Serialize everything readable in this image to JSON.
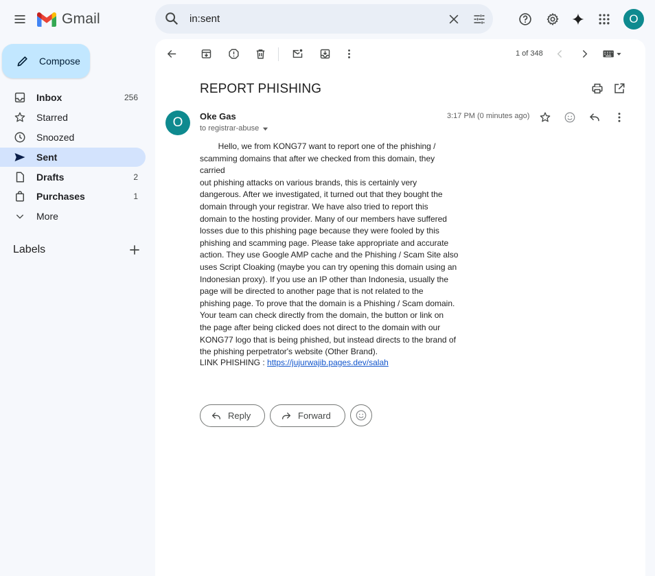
{
  "header": {
    "app_name": "Gmail",
    "search_value": "in:sent"
  },
  "user": {
    "initial": "O"
  },
  "sidebar": {
    "compose_label": "Compose",
    "items": [
      {
        "label": "Inbox",
        "count": "256"
      },
      {
        "label": "Starred",
        "count": ""
      },
      {
        "label": "Snoozed",
        "count": ""
      },
      {
        "label": "Sent",
        "count": ""
      },
      {
        "label": "Drafts",
        "count": "2"
      },
      {
        "label": "Purchases",
        "count": "1"
      },
      {
        "label": "More",
        "count": ""
      }
    ],
    "labels_heading": "Labels"
  },
  "toolbar": {
    "pager": "1 of 348"
  },
  "message": {
    "subject": "REPORT PHISHING",
    "sender_initial": "O",
    "sender_name": "Oke Gas",
    "recipient": "to registrar-abuse",
    "timestamp": "3:17 PM (0 minutes ago)",
    "body": "        Hello, we from KONG77 want to report one of the phishing /\nscamming domains that after we checked from this domain, they carried\nout phishing attacks on various brands, this is certainly very\ndangerous. After we investigated, it turned out that they bought the\ndomain through your registrar. We have also tried to report this\ndomain to the hosting provider. Many of our members have suffered\nlosses due to this phishing page because they were fooled by this\nphishing and scamming page. Please take appropriate and accurate\naction. They use Google AMP cache and the Phishing / Scam Site also\nuses Script Cloaking (maybe you can try opening this domain using an\nIndonesian proxy). If you use an IP other than Indonesia, usually the\npage will be directed to another page that is not related to the\nphishing page. To prove that the domain is a Phishing / Scam domain.\nYour team can check directly from the domain, the button or link on\nthe page after being clicked does not direct to the domain with our\nKONG77 logo that is being phished, but instead directs to the brand of\nthe phishing perpetrator's website (Other Brand).",
    "link_prefix": "LINK PHISHING : ",
    "link_text": "https://jujurwajib.pages.dev/salah"
  },
  "actions": {
    "reply_label": "Reply",
    "forward_label": "Forward"
  },
  "colors": {
    "accent_compose": "#c2e7ff",
    "active_nav": "#d3e3fd",
    "avatar": "#0e8a8f",
    "link": "#1155cc"
  }
}
